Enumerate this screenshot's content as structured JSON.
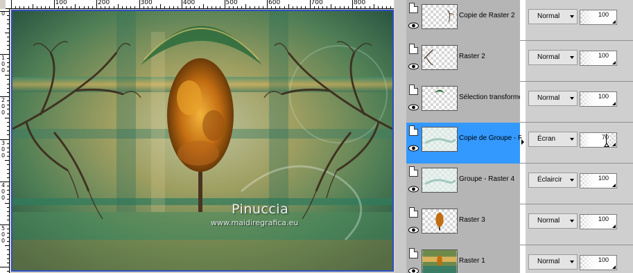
{
  "ruler": {
    "horizontal_labels": [
      "100",
      "200",
      "300",
      "400",
      "500",
      "600",
      "700",
      "800"
    ],
    "vertical_labels": [
      [
        "1",
        "0",
        "0"
      ],
      [
        "2",
        "0",
        "0"
      ],
      [
        "3",
        "0",
        "0"
      ],
      [
        "4",
        "0",
        "0"
      ],
      [
        "5",
        "0",
        "0"
      ]
    ],
    "origin_label": "0"
  },
  "canvas": {
    "watermark_title": "Pinuccia",
    "watermark_url": "www.maidiregrafica.eu"
  },
  "colors": {
    "selection": "#3399ff",
    "canvas_border": "#2d4fc4",
    "layer_bg": "#b5b5b5"
  },
  "layers": [
    {
      "name": "Copie de Raster 2",
      "blend": "Normal",
      "opacity": "100",
      "thumb": "transparent-small-branch",
      "selected": false
    },
    {
      "name": "Raster 2",
      "blend": "Normal",
      "opacity": "100",
      "thumb": "transparent-tree-left",
      "selected": false
    },
    {
      "name": "Sélection transformée",
      "blend": "Normal",
      "opacity": "100",
      "thumb": "transparent-arc",
      "selected": false
    },
    {
      "name": "Copie de Groupe - Raster 4",
      "blend": "Écran",
      "opacity": "70",
      "thumb": "faded-landscape",
      "selected": true
    },
    {
      "name": "Groupe - Raster 4",
      "blend": "Éclaircir",
      "opacity": "100",
      "thumb": "faded-landscape",
      "selected": false
    },
    {
      "name": "Raster 3",
      "blend": "Normal",
      "opacity": "100",
      "thumb": "autumn-tree",
      "selected": false
    },
    {
      "name": "Raster 1",
      "blend": "Normal",
      "opacity": "100",
      "thumb": "full-background",
      "selected": false
    }
  ]
}
